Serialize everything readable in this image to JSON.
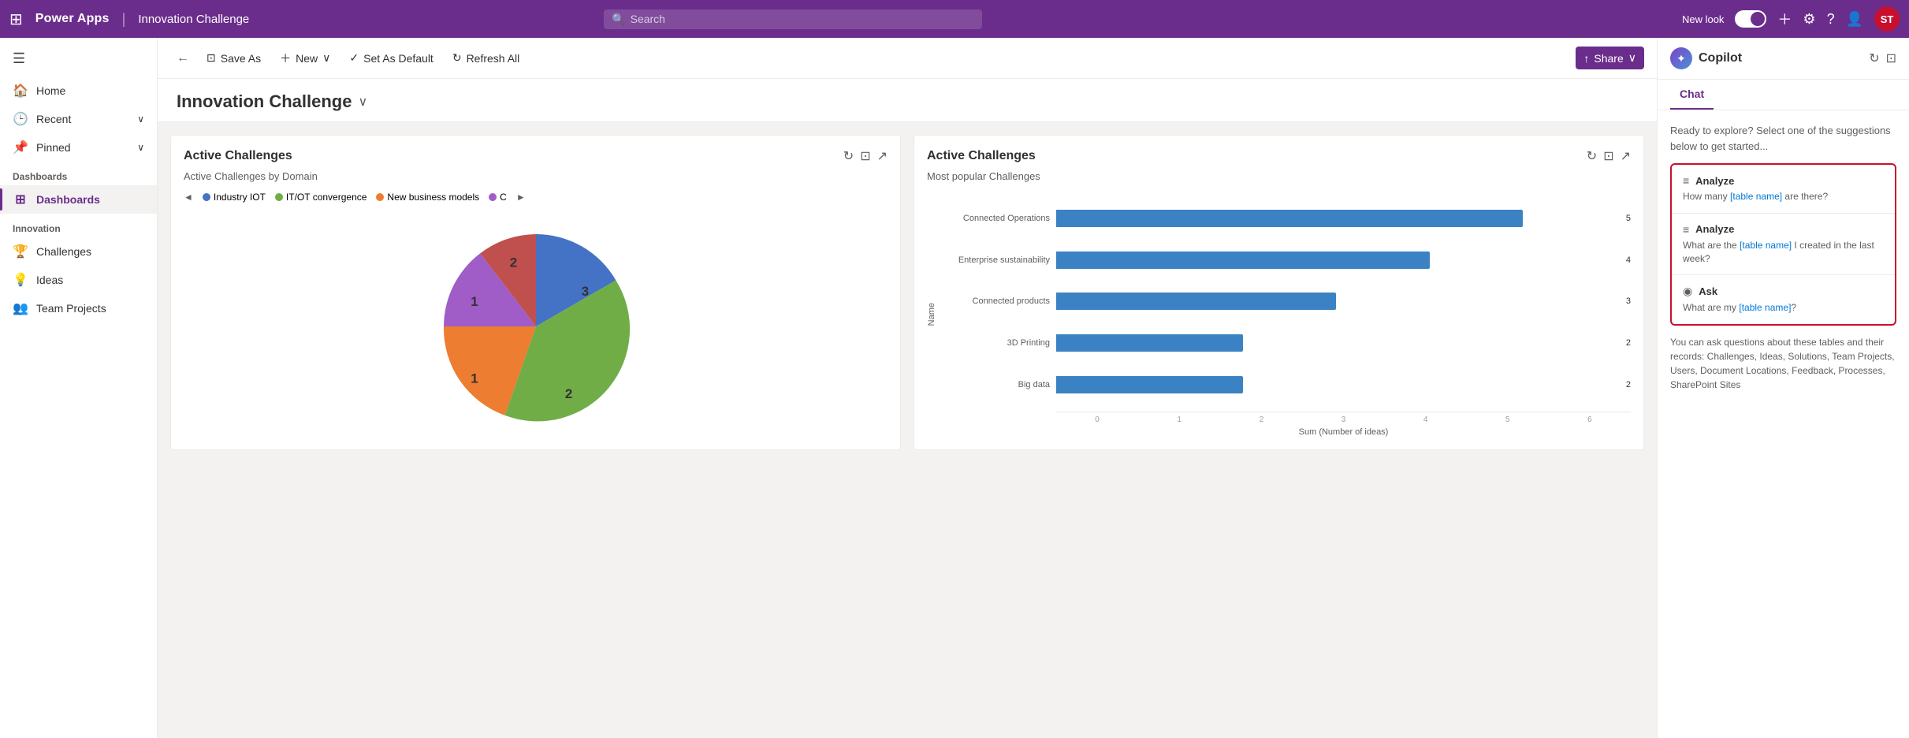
{
  "app": {
    "name": "Power Apps",
    "context": "Innovation Challenge",
    "avatar_initials": "ST"
  },
  "topnav": {
    "search_placeholder": "Search",
    "new_look_label": "New look",
    "toggle_on": true
  },
  "toolbar": {
    "back_label": "←",
    "save_as_label": "Save As",
    "new_label": "New",
    "set_as_default_label": "Set As Default",
    "refresh_all_label": "Refresh All",
    "share_label": "Share"
  },
  "dashboard": {
    "title": "Innovation Challenge",
    "chart1": {
      "title": "Active Challenges",
      "subtitle": "Active Challenges by Domain",
      "legend": [
        {
          "label": "Industry IOT",
          "color": "#4472c4"
        },
        {
          "label": "IT/OT convergence",
          "color": "#70ad47"
        },
        {
          "label": "New business models",
          "color": "#ed7d31"
        },
        {
          "label": "C",
          "color": "#a05cc7"
        }
      ],
      "slices": [
        {
          "label": "3",
          "color": "#4472c4",
          "value": 3
        },
        {
          "label": "2",
          "color": "#70ad47",
          "value": 2
        },
        {
          "label": "1",
          "color": "#ed7d31",
          "value": 1
        },
        {
          "label": "1",
          "color": "#a05cc7",
          "value": 1
        },
        {
          "label": "2",
          "color": "#c0504d",
          "value": 2
        }
      ]
    },
    "chart2": {
      "title": "Active Challenges",
      "subtitle": "Most popular Challenges",
      "x_label": "Sum (Number of ideas)",
      "y_label": "Name",
      "bars": [
        {
          "label": "Connected Operations",
          "value": 5,
          "max": 6
        },
        {
          "label": "Enterprise sustainability",
          "value": 4,
          "max": 6
        },
        {
          "label": "Connected products",
          "value": 3,
          "max": 6
        },
        {
          "label": "3D Printing",
          "value": 2,
          "max": 6
        },
        {
          "label": "Big data",
          "value": 2,
          "max": 6
        }
      ],
      "axis_ticks": [
        "0",
        "1",
        "2",
        "3",
        "4",
        "5",
        "6"
      ]
    }
  },
  "sidebar": {
    "sections": [
      {
        "label": "",
        "items": [
          {
            "id": "home",
            "label": "Home",
            "icon": "🏠",
            "has_chevron": false
          },
          {
            "id": "recent",
            "label": "Recent",
            "icon": "🕒",
            "has_chevron": true
          },
          {
            "id": "pinned",
            "label": "Pinned",
            "icon": "📌",
            "has_chevron": true
          }
        ]
      },
      {
        "label": "Dashboards",
        "items": [
          {
            "id": "dashboards",
            "label": "Dashboards",
            "icon": "⊞",
            "active": true
          }
        ]
      },
      {
        "label": "Innovation",
        "items": [
          {
            "id": "challenges",
            "label": "Challenges",
            "icon": "🏆"
          },
          {
            "id": "ideas",
            "label": "Ideas",
            "icon": "💡"
          },
          {
            "id": "team-projects",
            "label": "Team Projects",
            "icon": "👥"
          }
        ]
      }
    ]
  },
  "copilot": {
    "title": "Copilot",
    "tabs": [
      {
        "id": "chat",
        "label": "Chat",
        "active": true
      }
    ],
    "intro": "Ready to explore? Select one of the suggestions below to get started...",
    "suggestions": [
      {
        "type": "Analyze",
        "icon": "≡",
        "text_before": "How many ",
        "link": "[table name]",
        "text_after": " are there?"
      },
      {
        "type": "Analyze",
        "icon": "≡",
        "text_before": "What are the ",
        "link": "[table name]",
        "text_after": " I created in the last week?"
      },
      {
        "type": "Ask",
        "icon": "◉",
        "text_before": "What are my ",
        "link": "[table name]",
        "text_after": "?"
      }
    ],
    "footer": "You can ask questions about these tables and their records: Challenges, Ideas, Solutions, Team Projects, Users, Document Locations, Feedback, Processes, SharePoint Sites"
  }
}
